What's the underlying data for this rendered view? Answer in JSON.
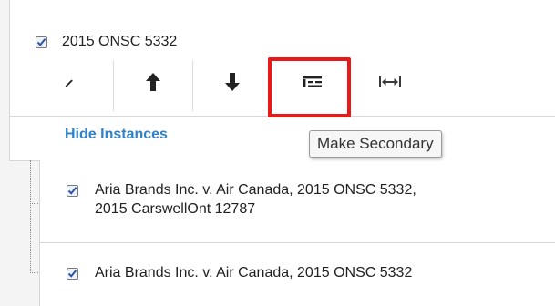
{
  "citation": {
    "label": "2015 ONSC 5332",
    "checked": true
  },
  "toolbar": {
    "buttons": [
      {
        "name": "edit",
        "icon": "pencil-icon"
      },
      {
        "name": "move-up",
        "icon": "arrow-up-icon"
      },
      {
        "name": "move-down",
        "icon": "arrow-down-icon"
      },
      {
        "name": "make-secondary",
        "icon": "make-secondary-icon",
        "highlighted": true
      },
      {
        "name": "expand-width",
        "icon": "expand-horizontal-icon"
      }
    ]
  },
  "hide_instances_label": "Hide Instances",
  "tooltip": {
    "text": "Make Secondary"
  },
  "instances": [
    {
      "line1": "Aria Brands Inc. v. Air Canada, 2015 ONSC 5332,",
      "line2": "2015 CarswellOnt 12787",
      "checked": true
    },
    {
      "line1": "Aria Brands Inc. v. Air Canada, 2015 ONSC 5332",
      "line2": "",
      "checked": true
    }
  ],
  "colors": {
    "link": "#2f81c9",
    "highlight": "#e81919",
    "background": "#f4f4f4"
  }
}
